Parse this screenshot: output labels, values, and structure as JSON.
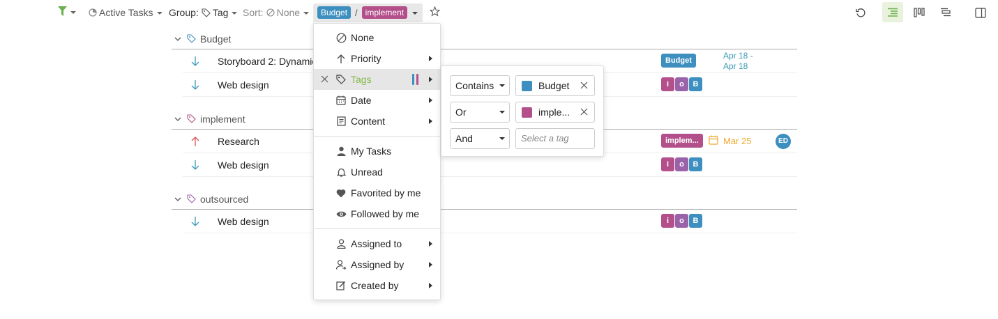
{
  "toolbar": {
    "active_tasks": "Active Tasks",
    "group_label": "Group:",
    "group_value": "Tag",
    "sort_label": "Sort:",
    "sort_value": "None",
    "filter_chip_1": "Budget",
    "filter_separator": "/",
    "filter_chip_2": "implement"
  },
  "groups": [
    {
      "name": "Budget",
      "tasks": [
        {
          "title": "Storyboard 2: Dynamic",
          "priority": "low",
          "tag_chip": "Budget",
          "date": "Apr 18 -",
          "date2": "Apr 18"
        },
        {
          "title": "Web design",
          "priority": "low",
          "tags": [
            "i",
            "o",
            "B"
          ]
        }
      ]
    },
    {
      "name": "implement",
      "tasks": [
        {
          "title": "Research",
          "priority": "high",
          "tag_chip": "implem...",
          "date": "Mar 25",
          "avatar": "ED"
        },
        {
          "title": "Web design",
          "priority": "low",
          "tags": [
            "i",
            "o",
            "B"
          ]
        }
      ]
    },
    {
      "name": "outsourced",
      "tasks": [
        {
          "title": "Web design",
          "priority": "low",
          "tags": [
            "i",
            "o",
            "B"
          ]
        }
      ]
    }
  ],
  "menu": {
    "items": [
      {
        "label": "None",
        "icon": "none-icon"
      },
      {
        "label": "Priority",
        "icon": "arrow-up-icon"
      },
      {
        "label": "Tags",
        "icon": "tag-icon",
        "active": true
      },
      {
        "label": "Date",
        "icon": "calendar-icon"
      },
      {
        "label": "Content",
        "icon": "content-icon"
      },
      {
        "label": "My Tasks",
        "icon": "person-icon"
      },
      {
        "label": "Unread",
        "icon": "bell-icon"
      },
      {
        "label": "Favorited by me",
        "icon": "heart-icon"
      },
      {
        "label": "Followed by me",
        "icon": "eye-icon"
      },
      {
        "label": "Assigned to",
        "icon": "assigned-to-icon"
      },
      {
        "label": "Assigned by",
        "icon": "assigned-by-icon"
      },
      {
        "label": "Created by",
        "icon": "created-by-icon"
      }
    ]
  },
  "tag_filter": {
    "rows": [
      {
        "operator": "Contains",
        "tag": "Budget"
      },
      {
        "operator": "Or",
        "tag": "imple..."
      },
      {
        "operator": "And",
        "placeholder": "Select a tag"
      }
    ]
  },
  "colors": {
    "budget": "#3d8fbf",
    "implement": "#b34f8a",
    "accent_green": "#86b84a",
    "date_teal": "#3a9ab8",
    "date_orange": "#f0a830",
    "priority_low": "#3a9ab8",
    "priority_high": "#d9534f"
  }
}
